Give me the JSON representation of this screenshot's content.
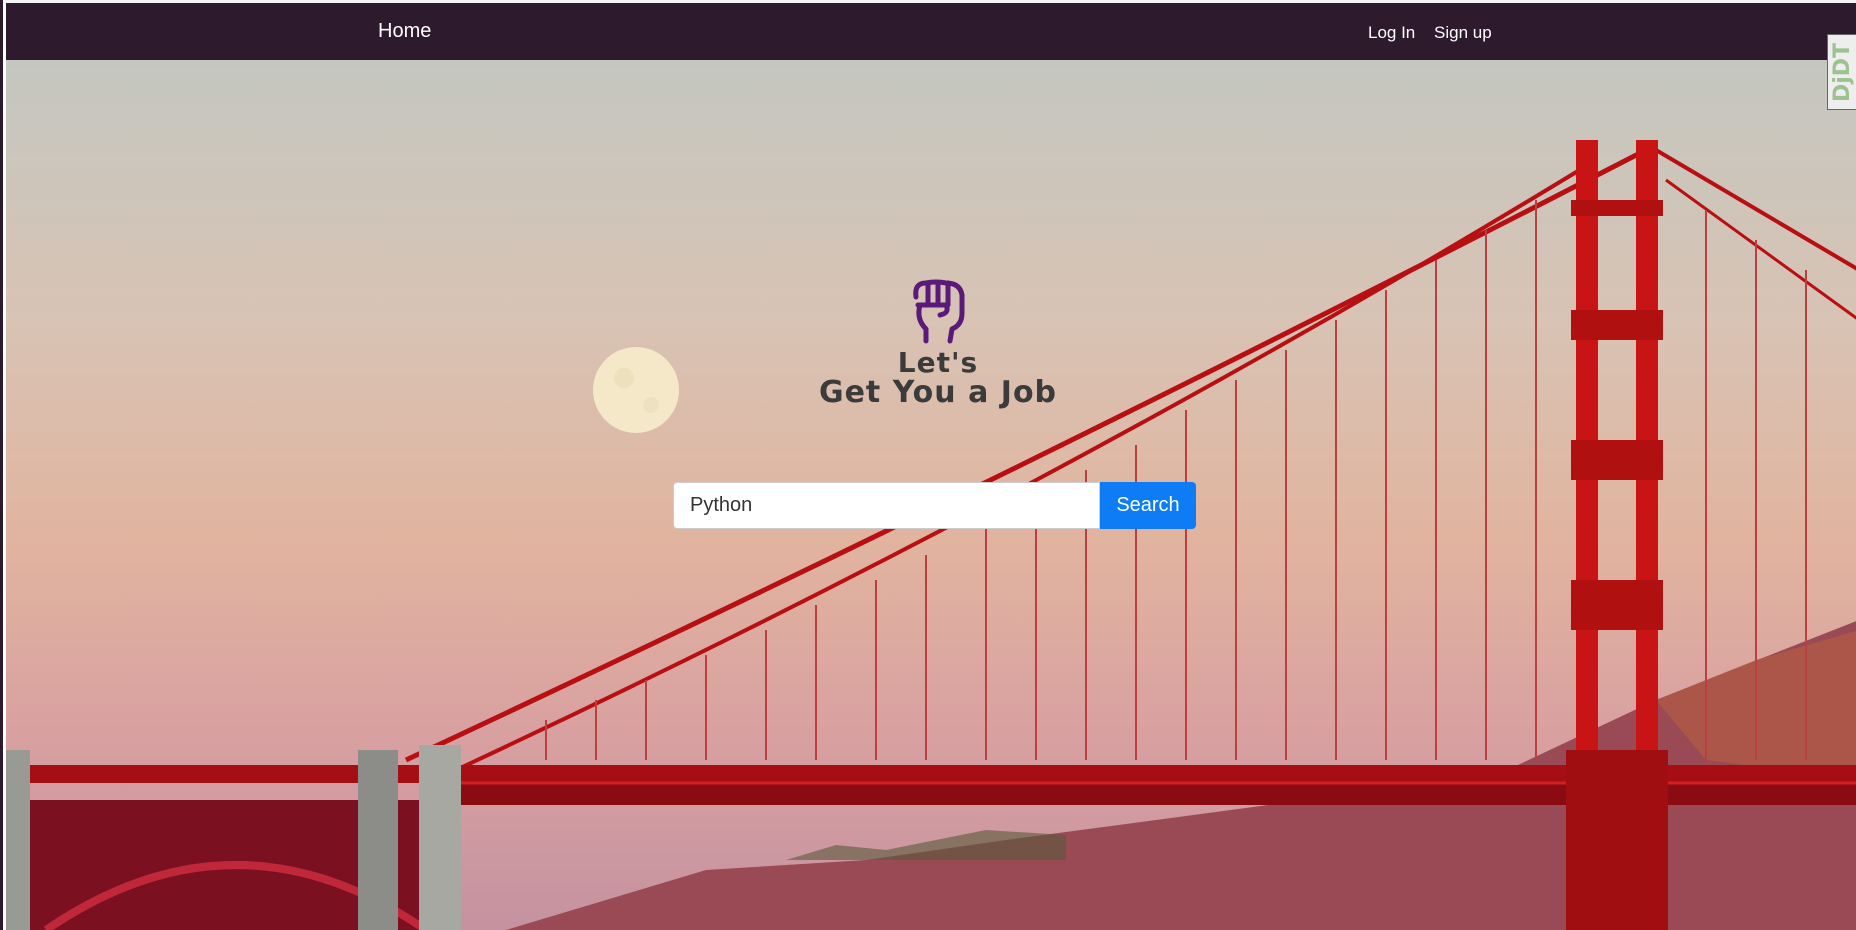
{
  "navbar": {
    "home_label": "Home",
    "login_label": "Log In",
    "signup_label": "Sign up"
  },
  "logo": {
    "line1": "Let's",
    "line2": "Get You a Job"
  },
  "search": {
    "value": "Python",
    "button_label": "Search"
  },
  "debug_toolbar": {
    "label": "DjDT"
  },
  "colors": {
    "navbar": "#2d1a2c",
    "button": "#0d7cf5",
    "logo_fist": "#5b1a7a",
    "bridge": "#c81414"
  },
  "icons": [
    "fist-icon"
  ]
}
